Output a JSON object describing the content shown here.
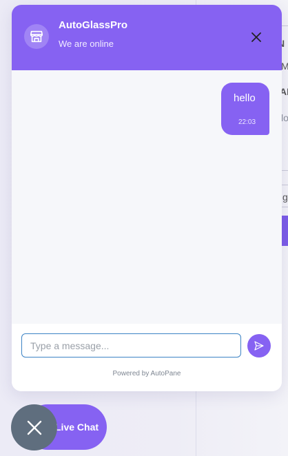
{
  "background_page": {
    "fragments": [
      "N",
      "M",
      "AL",
      "lo",
      "g"
    ]
  },
  "chat": {
    "header": {
      "title": "AutoGlassPro",
      "status": "We are online",
      "avatar_icon": "store-icon",
      "close_icon": "close-icon"
    },
    "messages": [
      {
        "text": "hello",
        "time": "22:03",
        "from": "user"
      }
    ],
    "composer": {
      "placeholder": "Type a message...",
      "value": "",
      "send_icon": "send-icon"
    },
    "footer": "Powered by AutoPane"
  },
  "launcher": {
    "label": "Live Chat",
    "toggle_icon": "close-icon"
  },
  "colors": {
    "accent": "#8662f2",
    "toggle": "#5f6e7e",
    "input_border": "#3b82c4"
  }
}
